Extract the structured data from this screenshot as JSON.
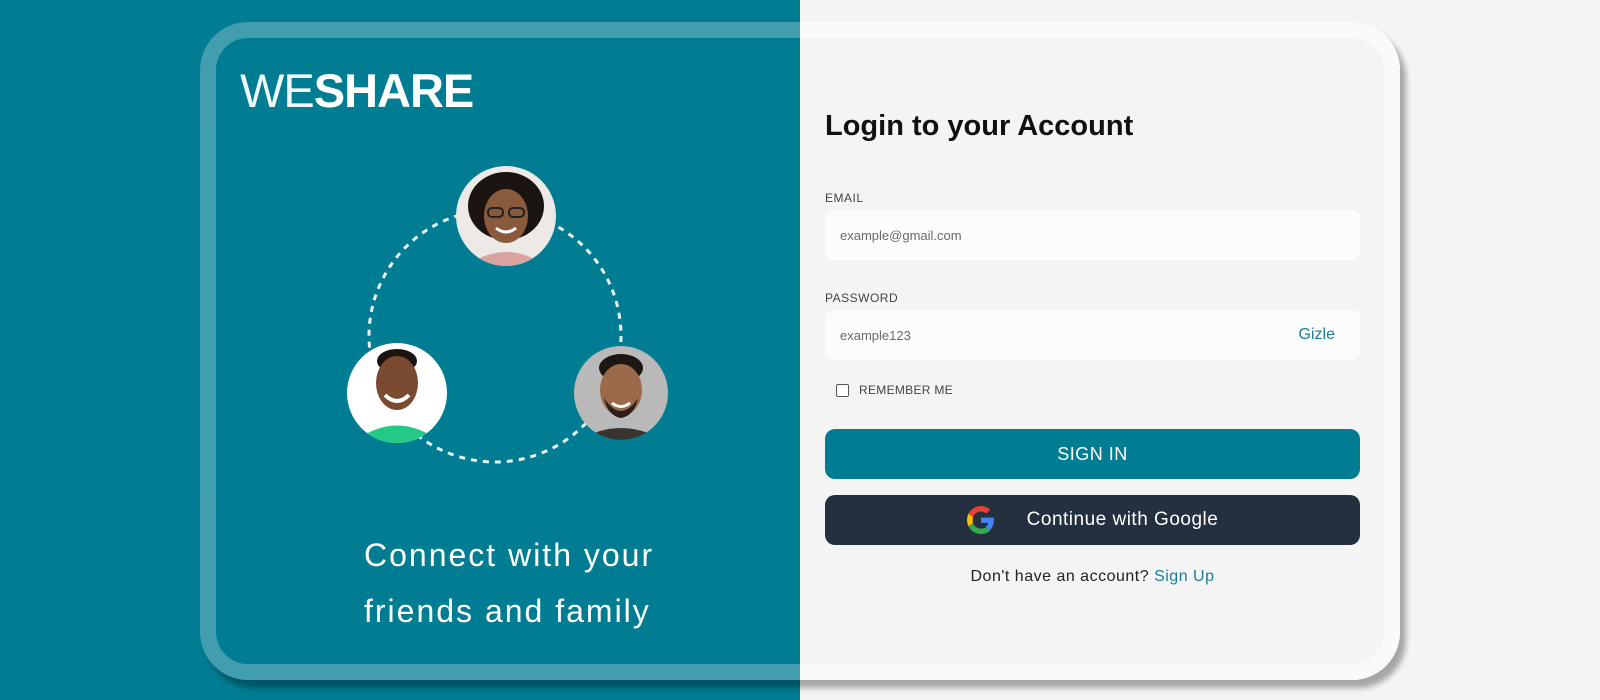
{
  "brand": {
    "logo_thin": "WE",
    "logo_bold": "SHARE"
  },
  "hero": {
    "tagline_line1": "Connect with your",
    "tagline_line2": "friends and family"
  },
  "login": {
    "title": "Login to your Account",
    "email_label": "EMAIL",
    "email_placeholder": "example@gmail.com",
    "password_label": "PASSWORD",
    "password_placeholder": "example123",
    "password_toggle": "Gizle",
    "remember_label": "REMEMBER ME",
    "signin_label": "SIGN IN",
    "google_label": "Continue with Google",
    "signup_prompt": "Don't have an account?",
    "signup_link": "Sign Up"
  },
  "colors": {
    "primary": "#007d93",
    "dark_button": "#242f40",
    "link": "#1a7d91",
    "panel_bg": "#f4f4f4"
  },
  "icons": [
    "google-icon",
    "checkbox-icon"
  ]
}
